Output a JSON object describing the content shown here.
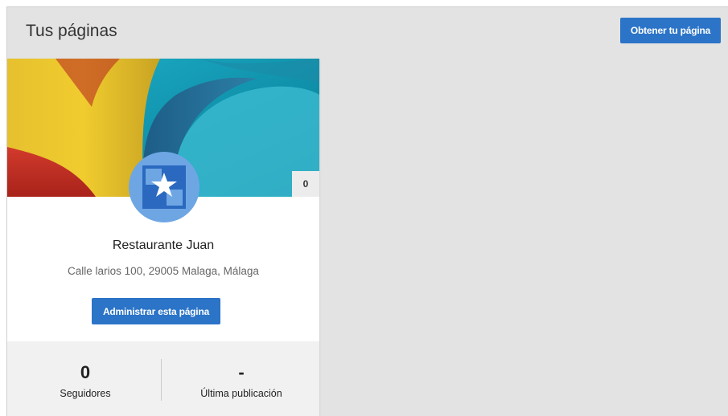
{
  "header": {
    "title": "Tus páginas",
    "get_page_label": "Obtener tu página"
  },
  "card": {
    "cover_badge": "0",
    "avatar_icon": "building-icon",
    "name": "Restaurante Juan",
    "address": "Calle larios 100, 29005 Malaga, Málaga",
    "manage_label": "Administrar esta página",
    "stats": [
      {
        "value": "0",
        "label": "Seguidores"
      },
      {
        "value": "-",
        "label": "Última publicación"
      }
    ]
  },
  "colors": {
    "accent": "#2b74c7",
    "avatar": "#6ea6e4",
    "avatar_icon": "#2a69bf",
    "background": "#e3e3e3"
  }
}
